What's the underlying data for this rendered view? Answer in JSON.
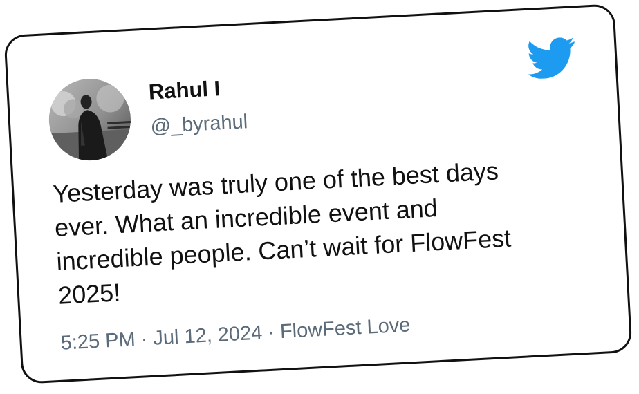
{
  "tweet": {
    "author_name": "Rahul I",
    "handle": "@_byrahul",
    "text_lines": [
      "Yesterday was truly one of the best days",
      "ever. What an incredible event and",
      "incredible people. Can’t wait for FlowFest",
      "2025!"
    ],
    "time": "5:25 PM",
    "separator": "·",
    "date": "Jul 12, 2024",
    "source": "FlowFest Love"
  },
  "icons": {
    "brand": "twitter-bird-icon",
    "avatar": "profile-photo"
  },
  "colors": {
    "brand_blue": "#1d9bf0",
    "text_primary": "#111111",
    "text_secondary": "#5b6b79",
    "card_border": "#111111"
  }
}
